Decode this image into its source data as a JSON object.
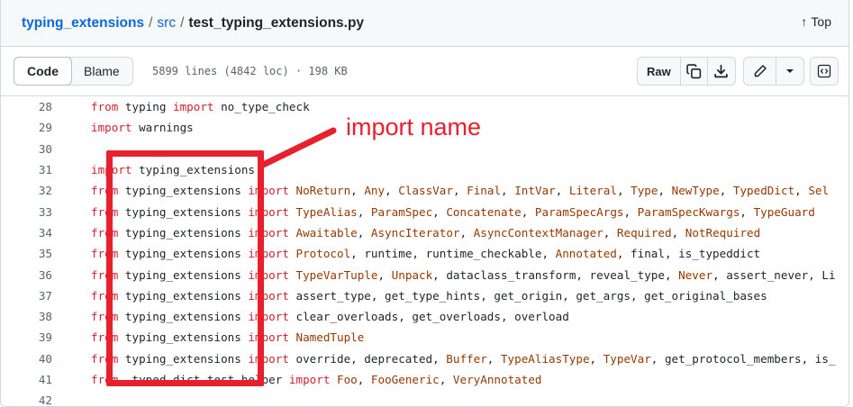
{
  "breadcrumb": {
    "repo": "typing_extensions",
    "folder": "src",
    "file": "test_typing_extensions.py",
    "separator": "/"
  },
  "top_link": {
    "arrow": "↑",
    "label": "Top"
  },
  "toolbar": {
    "code_label": "Code",
    "blame_label": "Blame",
    "file_info": "5899 lines (4842 loc) · 198 KB",
    "raw_label": "Raw",
    "icons": [
      "copy-icon",
      "download-icon",
      "pencil-icon",
      "chevron-down-icon",
      "symbols-icon"
    ]
  },
  "colors": {
    "keyword": "#cf222e",
    "class": "#953800",
    "link": "#0969da",
    "annotation": "#e8202e"
  },
  "annotation": {
    "label": "import name"
  },
  "lines": [
    {
      "n": "28",
      "tokens": [
        [
          "kw",
          "from"
        ],
        [
          "t",
          " typing "
        ],
        [
          "kw",
          "import"
        ],
        [
          "t",
          " no_type_check"
        ]
      ]
    },
    {
      "n": "29",
      "tokens": [
        [
          "kw",
          "import"
        ],
        [
          "t",
          " warnings"
        ]
      ]
    },
    {
      "n": "30",
      "tokens": []
    },
    {
      "n": "31",
      "tokens": [
        [
          "kw",
          "import"
        ],
        [
          "t",
          " typing_extensions"
        ]
      ]
    },
    {
      "n": "32",
      "tokens": [
        [
          "kw",
          "from"
        ],
        [
          "t",
          " typing_extensions "
        ],
        [
          "kw",
          "import"
        ],
        [
          "t",
          " "
        ],
        [
          "cls",
          "NoReturn"
        ],
        [
          "t",
          ", "
        ],
        [
          "cls",
          "Any"
        ],
        [
          "t",
          ", "
        ],
        [
          "cls",
          "ClassVar"
        ],
        [
          "t",
          ", "
        ],
        [
          "cls",
          "Final"
        ],
        [
          "t",
          ", "
        ],
        [
          "cls",
          "IntVar"
        ],
        [
          "t",
          ", "
        ],
        [
          "cls",
          "Literal"
        ],
        [
          "t",
          ", "
        ],
        [
          "cls",
          "Type"
        ],
        [
          "t",
          ", "
        ],
        [
          "cls",
          "NewType"
        ],
        [
          "t",
          ", "
        ],
        [
          "cls",
          "TypedDict"
        ],
        [
          "t",
          ", "
        ],
        [
          "cls",
          "Sel"
        ]
      ]
    },
    {
      "n": "33",
      "tokens": [
        [
          "kw",
          "from"
        ],
        [
          "t",
          " typing_extensions "
        ],
        [
          "kw",
          "import"
        ],
        [
          "t",
          " "
        ],
        [
          "cls",
          "TypeAlias"
        ],
        [
          "t",
          ", "
        ],
        [
          "cls",
          "ParamSpec"
        ],
        [
          "t",
          ", "
        ],
        [
          "cls",
          "Concatenate"
        ],
        [
          "t",
          ", "
        ],
        [
          "cls",
          "ParamSpecArgs"
        ],
        [
          "t",
          ", "
        ],
        [
          "cls",
          "ParamSpecKwargs"
        ],
        [
          "t",
          ", "
        ],
        [
          "cls",
          "TypeGuard"
        ]
      ]
    },
    {
      "n": "34",
      "tokens": [
        [
          "kw",
          "from"
        ],
        [
          "t",
          " typing_extensions "
        ],
        [
          "kw",
          "import"
        ],
        [
          "t",
          " "
        ],
        [
          "cls",
          "Awaitable"
        ],
        [
          "t",
          ", "
        ],
        [
          "cls",
          "AsyncIterator"
        ],
        [
          "t",
          ", "
        ],
        [
          "cls",
          "AsyncContextManager"
        ],
        [
          "t",
          ", "
        ],
        [
          "cls",
          "Required"
        ],
        [
          "t",
          ", "
        ],
        [
          "cls",
          "NotRequired"
        ]
      ]
    },
    {
      "n": "35",
      "tokens": [
        [
          "kw",
          "from"
        ],
        [
          "t",
          " typing_extensions "
        ],
        [
          "kw",
          "import"
        ],
        [
          "t",
          " "
        ],
        [
          "cls",
          "Protocol"
        ],
        [
          "t",
          ", runtime, runtime_checkable, "
        ],
        [
          "cls",
          "Annotated"
        ],
        [
          "t",
          ", final, is_typeddict"
        ]
      ]
    },
    {
      "n": "36",
      "tokens": [
        [
          "kw",
          "from"
        ],
        [
          "t",
          " typing_extensions "
        ],
        [
          "kw",
          "import"
        ],
        [
          "t",
          " "
        ],
        [
          "cls",
          "TypeVarTuple"
        ],
        [
          "t",
          ", "
        ],
        [
          "cls",
          "Unpack"
        ],
        [
          "t",
          ", dataclass_transform, reveal_type, "
        ],
        [
          "cls",
          "Never"
        ],
        [
          "t",
          ", assert_never, Li"
        ]
      ]
    },
    {
      "n": "37",
      "tokens": [
        [
          "kw",
          "from"
        ],
        [
          "t",
          " typing_extensions "
        ],
        [
          "kw",
          "import"
        ],
        [
          "t",
          " assert_type, get_type_hints, get_origin, get_args, get_original_bases"
        ]
      ]
    },
    {
      "n": "38",
      "tokens": [
        [
          "kw",
          "from"
        ],
        [
          "t",
          " typing_extensions "
        ],
        [
          "kw",
          "import"
        ],
        [
          "t",
          " clear_overloads, get_overloads, overload"
        ]
      ]
    },
    {
      "n": "39",
      "tokens": [
        [
          "kw",
          "from"
        ],
        [
          "t",
          " typing_extensions "
        ],
        [
          "kw",
          "import"
        ],
        [
          "t",
          " "
        ],
        [
          "cls",
          "NamedTuple"
        ]
      ]
    },
    {
      "n": "40",
      "tokens": [
        [
          "kw",
          "from"
        ],
        [
          "t",
          " typing_extensions "
        ],
        [
          "kw",
          "import"
        ],
        [
          "t",
          " override, deprecated, "
        ],
        [
          "cls",
          "Buffer"
        ],
        [
          "t",
          ", "
        ],
        [
          "cls",
          "TypeAliasType"
        ],
        [
          "t",
          ", "
        ],
        [
          "cls",
          "TypeVar"
        ],
        [
          "t",
          ", get_protocol_members, is_"
        ]
      ]
    },
    {
      "n": "41",
      "tokens": [
        [
          "kw",
          "from"
        ],
        [
          "t",
          " _typed_dict_test_helper "
        ],
        [
          "kw",
          "import"
        ],
        [
          "t",
          " "
        ],
        [
          "cls",
          "Foo"
        ],
        [
          "t",
          ", "
        ],
        [
          "cls",
          "FooGeneric"
        ],
        [
          "t",
          ", "
        ],
        [
          "cls",
          "VeryAnnotated"
        ]
      ]
    },
    {
      "n": "42",
      "tokens": []
    }
  ]
}
